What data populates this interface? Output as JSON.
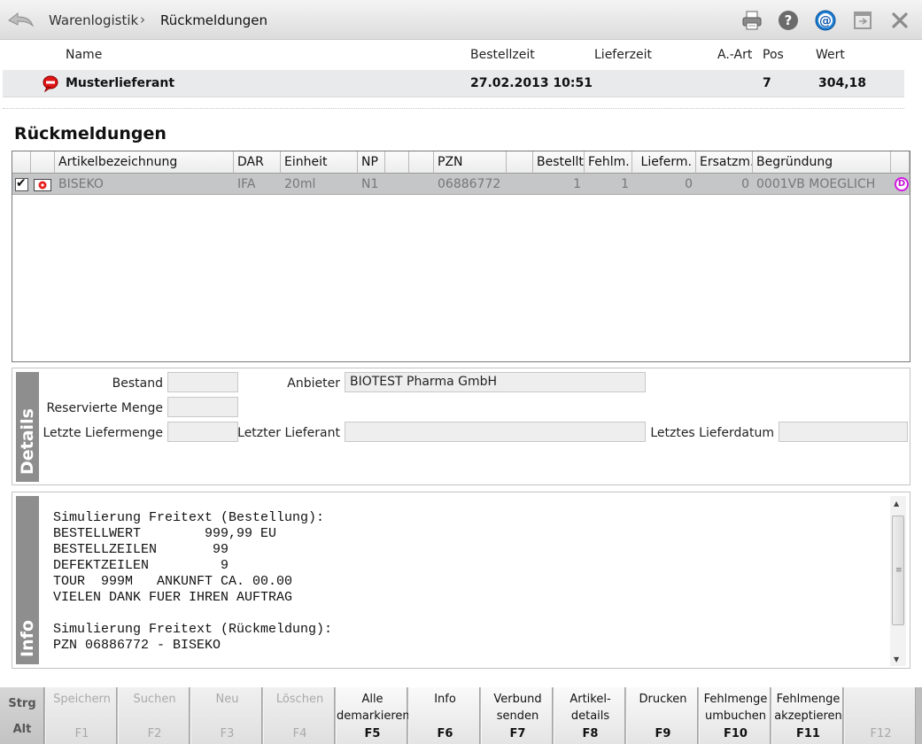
{
  "breadcrumb": {
    "parent": "Warenlogistik",
    "separator": "›",
    "current": "Rückmeldungen"
  },
  "toolbar": {
    "icons": [
      "printer-icon",
      "help-icon",
      "email-icon",
      "window-icon",
      "close-icon"
    ]
  },
  "order_header": {
    "columns": {
      "name": "Name",
      "bestellzeit": "Bestellzeit",
      "lieferzeit": "Lieferzeit",
      "aart": "A.-Art",
      "pos": "Pos",
      "wert": "Wert"
    },
    "row": {
      "name": "Musterlieferant",
      "bestellzeit": "27.02.2013 10:51",
      "lieferzeit": "",
      "aart": "",
      "pos": "7",
      "wert": "304,18"
    }
  },
  "section_title": "Rückmeldungen",
  "table": {
    "headers": [
      "",
      "",
      "Artikelbezeichnung",
      "DAR",
      "Einheit",
      "NP",
      "",
      "",
      "PZN",
      "",
      "Bestellt",
      "Fehlm.",
      "Lieferm.",
      "Ersatzm.",
      "Begründung",
      ""
    ],
    "rows": [
      {
        "checked": "✔",
        "artikel": "BISEKO",
        "dar": "IFA",
        "einheit": "20ml",
        "np": "N1",
        "pzn": "06886772",
        "bestellt": "1",
        "fehlm": "1",
        "lieferm": "0",
        "ersatzm": "0",
        "begruendung": "0001VB MOEGLICH",
        "badge": "D"
      }
    ]
  },
  "details": {
    "label": "Details",
    "bestand_label": "Bestand",
    "bestand_value": "",
    "reserviert_label": "Reservierte Menge",
    "reserviert_value": "",
    "letzte_liefermenge_label": "Letzte Liefermenge",
    "letzte_liefermenge_value": "",
    "anbieter_label": "Anbieter",
    "anbieter_value": "BIOTEST Pharma GmbH",
    "letzter_lieferant_label": "Letzter Lieferant",
    "letzter_lieferant_value": "",
    "letztes_lieferdatum_label": "Letztes Lieferdatum",
    "letztes_lieferdatum_value": ""
  },
  "info": {
    "label": "Info",
    "text": "Simulierung Freitext (Bestellung):\nBESTELLWERT        999,99 EU\nBESTELLZEILEN       99\nDEFEKTZEILEN         9\nTOUR  999M   ANKUNFT CA. 00.00\nVIELEN DANK FUER IHREN AUFTRAG\n\nSimulierung Freitext (Rückmeldung):\nPZN 06886772 - BISEKO"
  },
  "modifiers": {
    "strg": "Strg",
    "alt": "Alt"
  },
  "function_keys": [
    {
      "label": "Speichern",
      "code": "F1",
      "enabled": false
    },
    {
      "label": "Suchen",
      "code": "F2",
      "enabled": false
    },
    {
      "label": "Neu",
      "code": "F3",
      "enabled": false
    },
    {
      "label": "Löschen",
      "code": "F4",
      "enabled": false
    },
    {
      "label": "Alle\ndemarkieren",
      "code": "F5",
      "enabled": true
    },
    {
      "label": "Info",
      "code": "F6",
      "enabled": true
    },
    {
      "label": "Verbund\nsenden",
      "code": "F7",
      "enabled": true
    },
    {
      "label": "Artikel-\ndetails",
      "code": "F8",
      "enabled": true
    },
    {
      "label": "Drucken",
      "code": "F9",
      "enabled": true
    },
    {
      "label": "Fehlmenge\numbuchen",
      "code": "F10",
      "enabled": true
    },
    {
      "label": "Fehlmenge\nakzeptieren",
      "code": "F11",
      "enabled": true
    },
    {
      "label": "",
      "code": "F12",
      "enabled": false
    }
  ],
  "colors": {
    "accent_badge": "#d11be0",
    "selected_row": "#c5c6c8",
    "side_label": "#8e8e8e"
  }
}
